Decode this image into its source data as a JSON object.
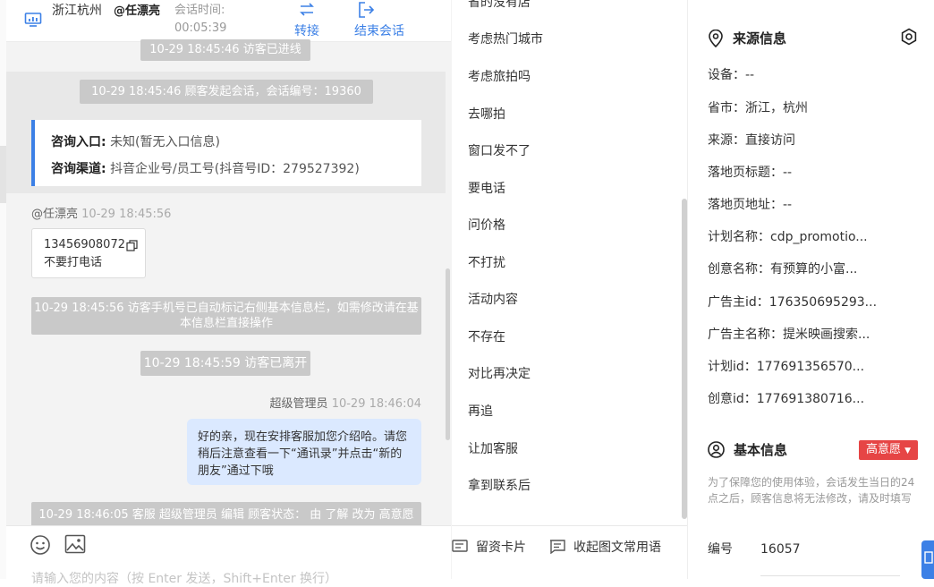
{
  "header": {
    "location": "浙江杭州",
    "user": "@任漂亮",
    "session_time_label": "会话时间:",
    "session_time": "00:05:39",
    "transfer": "转接",
    "end": "结束会话"
  },
  "chat": {
    "sys_enter": "10-29 18:45:46 访客已进线",
    "sys_start": "10-29 18:45:46 顾客发起会话，会话编号：19360",
    "info_entry_label": "咨询入口:",
    "info_entry_value": "未知(暂无入口信息)",
    "info_channel_label": "咨询渠道:",
    "info_channel_value": "抖音企业号/员工号(抖音号ID：279527392)",
    "visitor_name": "@任漂亮",
    "visitor_time": "10-29 18:45:56",
    "visitor_phone": "13456908072",
    "visitor_text": "不要打电话",
    "sys_phone_mark": "10-29 18:45:56 访客手机号已自动标记右侧基本信息栏，如需修改请在基本信息栏直接操作",
    "sys_leave": "10-29 18:45:59 访客已离开",
    "agent_name": "超级管理员",
    "agent_time": "10-29 18:46:04",
    "agent_msg": "好的亲，现在安排客服加您介绍哈。请您稍后注意查看一下“通讯录”并点击“新的朋友”通过下哦",
    "sys_status": "10-29 18:46:05 客服 超级管理员 编辑 顾客状态： 由 了解 改为 高意愿",
    "input_placeholder": "请输入您的内容（按 Enter 发送，Shift+Enter 换行）"
  },
  "quick_replies": {
    "items": [
      "省的没有店",
      "考虑热门城市",
      "考虑旅拍吗",
      "去哪拍",
      "窗口发不了",
      "要电话",
      "问价格",
      "不打扰",
      "活动内容",
      "不存在",
      "对比再决定",
      "再追",
      "让加客服",
      "拿到联系后"
    ],
    "card_btn": "留资卡片",
    "collapse_btn": "收起图文常用语"
  },
  "source_info": {
    "title": "来源信息",
    "rows": [
      "设备：--",
      "省市：浙江，杭州",
      "来源：直接访问",
      "落地页标题：--",
      "落地页地址：--",
      "计划名称：cdp_promotio...",
      "创意名称：有预算的小富...",
      "广告主id：176350695293...",
      "广告主名称：提米映画搜索...",
      "计划id：177691356570...",
      "创意id：177691380716..."
    ]
  },
  "basic_info": {
    "title": "基本信息",
    "badge": "高意愿",
    "note": "为了保障您的使用体验，会话发生当日的24点之后，顾客信息将无法修改，请及时填写",
    "id_label": "编号",
    "id_value": "16057"
  },
  "colors": {
    "accent": "#3c80e6",
    "badge": "#e64545"
  }
}
